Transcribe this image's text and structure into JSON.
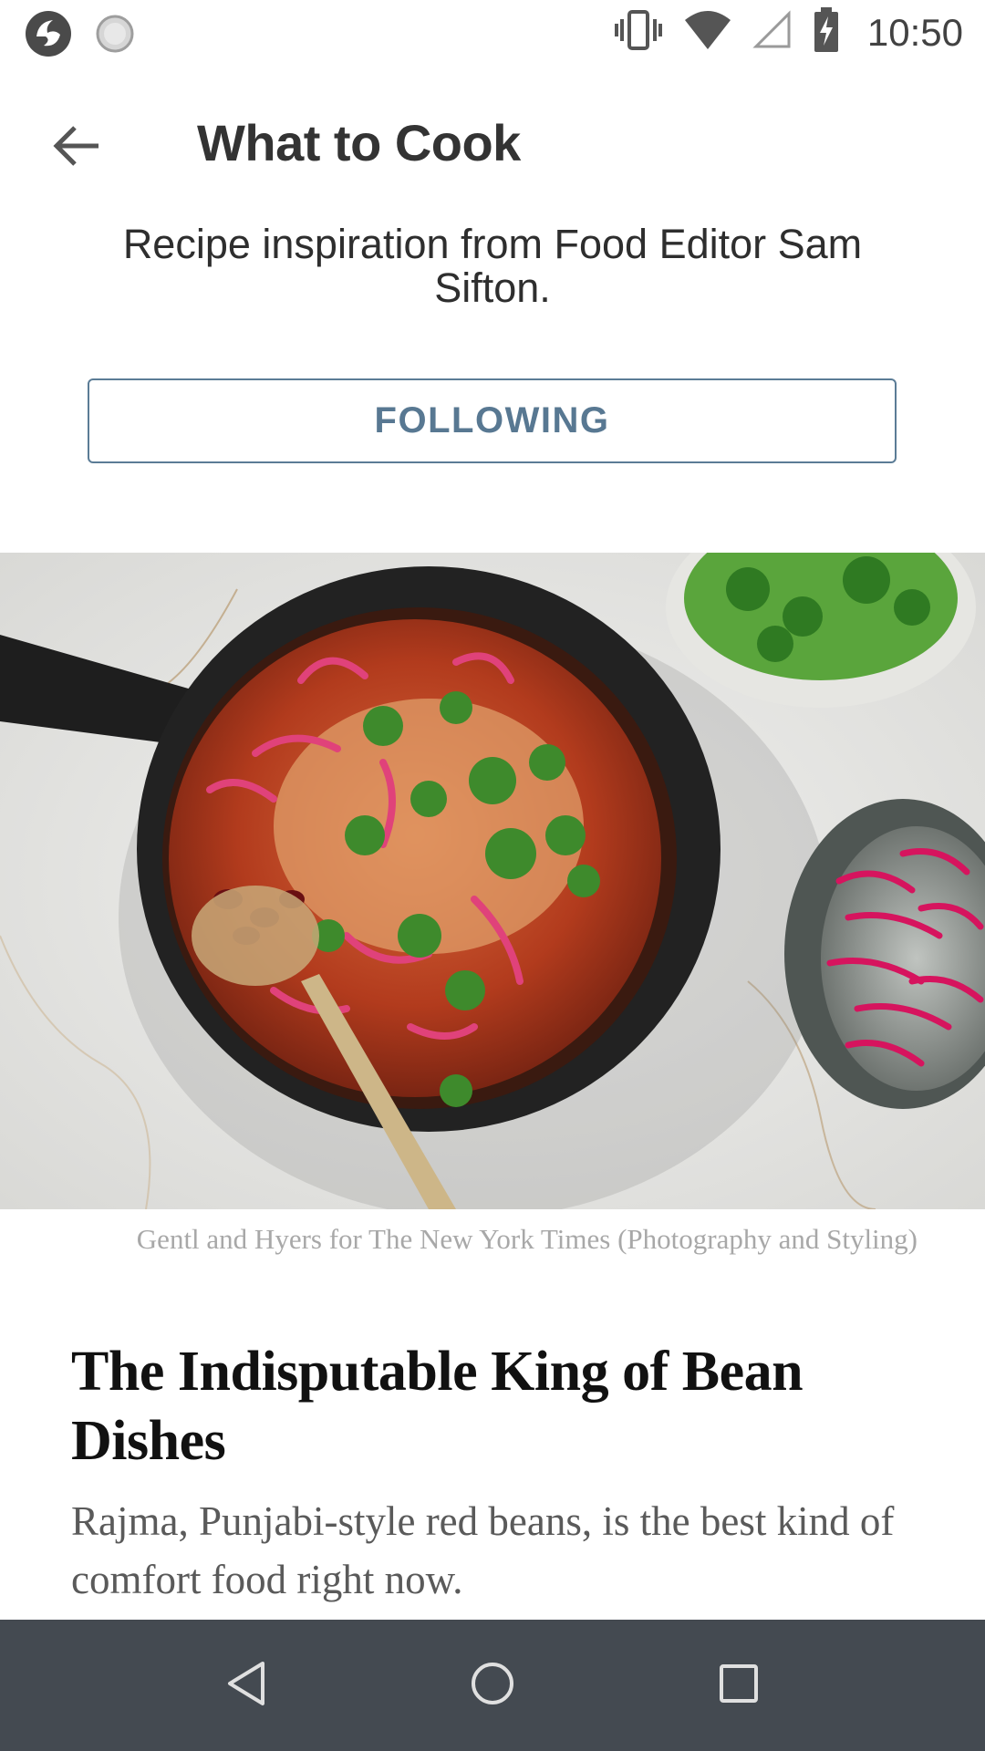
{
  "status_bar": {
    "time": "10:50",
    "icons": [
      "app-logo-icon",
      "loading-icon",
      "vibrate-icon",
      "wifi-icon",
      "signal-icon",
      "battery-charging-icon"
    ]
  },
  "app_bar": {
    "back_icon": "arrow-left-icon",
    "title": "What to Cook"
  },
  "header": {
    "subtitle": "Recipe inspiration from Food Editor Sam Sifton.",
    "follow_button_label": "FOLLOWING"
  },
  "article": {
    "photo_credit": "Gentl and Hyers for The New York Times (Photography and Styling)",
    "headline": "The Indisputable King of Bean Dishes",
    "summary": "Rajma, Punjabi-style red beans, is the best kind of comfort food right now."
  },
  "nav_bar": {
    "icons": [
      "back-triangle-icon",
      "home-circle-icon",
      "recents-square-icon"
    ]
  },
  "colors": {
    "follow_accent": "#587892",
    "nav_bar_bg": "#444a51",
    "headline": "#111111",
    "summary": "#5a5a5a",
    "credit": "#a8a8a8"
  }
}
